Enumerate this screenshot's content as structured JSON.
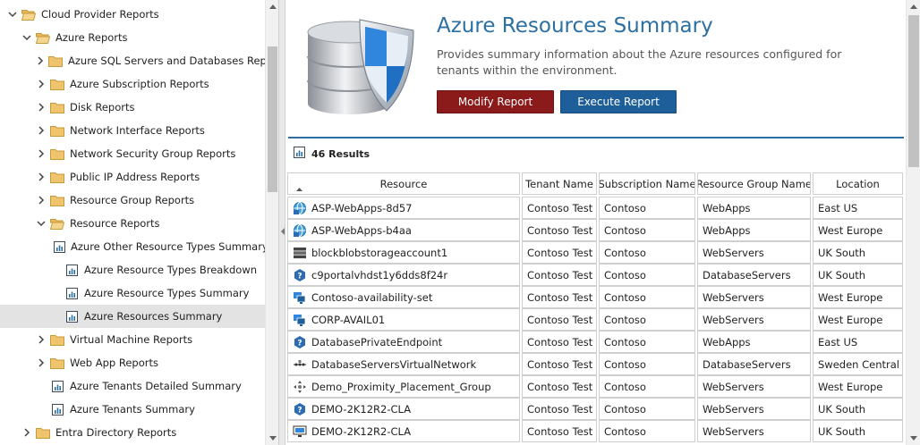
{
  "tree": {
    "items": [
      {
        "label": "Cloud Provider Reports",
        "level": 0,
        "kind": "folder",
        "expanded": true
      },
      {
        "label": "Azure Reports",
        "level": 1,
        "kind": "folder",
        "expanded": true
      },
      {
        "label": "Azure SQL Servers and Databases Reports",
        "level": 2,
        "kind": "folder",
        "expanded": false
      },
      {
        "label": "Azure Subscription Reports",
        "level": 2,
        "kind": "folder",
        "expanded": false
      },
      {
        "label": "Disk Reports",
        "level": 2,
        "kind": "folder",
        "expanded": false
      },
      {
        "label": "Network Interface Reports",
        "level": 2,
        "kind": "folder",
        "expanded": false
      },
      {
        "label": "Network Security Group Reports",
        "level": 2,
        "kind": "folder",
        "expanded": false
      },
      {
        "label": "Public IP Address Reports",
        "level": 2,
        "kind": "folder",
        "expanded": false
      },
      {
        "label": "Resource Group Reports",
        "level": 2,
        "kind": "folder",
        "expanded": false
      },
      {
        "label": "Resource Reports",
        "level": 2,
        "kind": "folder",
        "expanded": true
      },
      {
        "label": "Azure Other Resource Types Summary",
        "level": 3,
        "kind": "report"
      },
      {
        "label": "Azure Resource Types Breakdown",
        "level": 3,
        "kind": "report"
      },
      {
        "label": "Azure Resource Types Summary",
        "level": 3,
        "kind": "report"
      },
      {
        "label": "Azure Resources Summary",
        "level": 3,
        "kind": "report",
        "selected": true
      },
      {
        "label": "Virtual Machine Reports",
        "level": 2,
        "kind": "folder",
        "expanded": false
      },
      {
        "label": "Web App Reports",
        "level": 2,
        "kind": "folder",
        "expanded": false
      },
      {
        "label": "Azure Tenants Detailed Summary",
        "level": 2,
        "kind": "report"
      },
      {
        "label": "Azure Tenants Summary",
        "level": 2,
        "kind": "report"
      },
      {
        "label": "Entra Directory Reports",
        "level": 1,
        "kind": "folder",
        "expanded": false
      }
    ]
  },
  "report": {
    "title": "Azure Resources Summary",
    "description": "Provides summary information about the Azure resources configured for tenants within the environment.",
    "modify_label": "Modify Report",
    "execute_label": "Execute Report",
    "results_label": "46 Results"
  },
  "grid": {
    "columns": [
      "Resource",
      "Tenant Name",
      "Subscription Name",
      "Resource Group Name",
      "Location"
    ],
    "rows": [
      {
        "icon": "web-app-icon",
        "cells": [
          "ASP-WebApps-8d57",
          "Contoso Test",
          "Contoso",
          "WebApps",
          "East US"
        ]
      },
      {
        "icon": "web-app-icon",
        "cells": [
          "ASP-WebApps-b4aa",
          "Contoso Test",
          "Contoso",
          "WebApps",
          "West Europe"
        ]
      },
      {
        "icon": "storage-icon",
        "cells": [
          "blockblobstorageaccount1",
          "Contoso Test",
          "Contoso",
          "WebServers",
          "UK South"
        ]
      },
      {
        "icon": "unknown-resource-icon",
        "cells": [
          "c9portalvhdst1y6dds8f24r",
          "Contoso Test",
          "Contoso",
          "DatabaseServers",
          "UK South"
        ]
      },
      {
        "icon": "availability-set-icon",
        "cells": [
          "Contoso-availability-set",
          "Contoso Test",
          "Contoso",
          "WebServers",
          "West Europe"
        ]
      },
      {
        "icon": "availability-set-icon",
        "cells": [
          "CORP-AVAIL01",
          "Contoso Test",
          "Contoso",
          "WebServers",
          "West Europe"
        ]
      },
      {
        "icon": "unknown-resource-icon",
        "cells": [
          "DatabasePrivateEndpoint",
          "Contoso Test",
          "Contoso",
          "WebApps",
          "East US"
        ]
      },
      {
        "icon": "virtual-network-icon",
        "cells": [
          "DatabaseServersVirtualNetwork",
          "Contoso Test",
          "Contoso",
          "DatabaseServers",
          "Sweden Central"
        ]
      },
      {
        "icon": "placement-group-icon",
        "cells": [
          "Demo_Proximity_Placement_Group",
          "Contoso Test",
          "Contoso",
          "WebServers",
          "West Europe"
        ]
      },
      {
        "icon": "unknown-resource-icon",
        "cells": [
          "DEMO-2K12R2-CLA",
          "Contoso Test",
          "Contoso",
          "WebServers",
          "UK South"
        ]
      },
      {
        "icon": "virtual-machine-icon",
        "cells": [
          "DEMO-2K12R2-CLA",
          "Contoso Test",
          "Contoso",
          "WebServers",
          "UK South"
        ]
      }
    ]
  },
  "colors": {
    "title": "#2b6fa3",
    "modify_button": "#8b1a1a",
    "execute_button": "#1f5f99",
    "folder": "#f0c36d",
    "selected_row": "#e3e3e3"
  }
}
